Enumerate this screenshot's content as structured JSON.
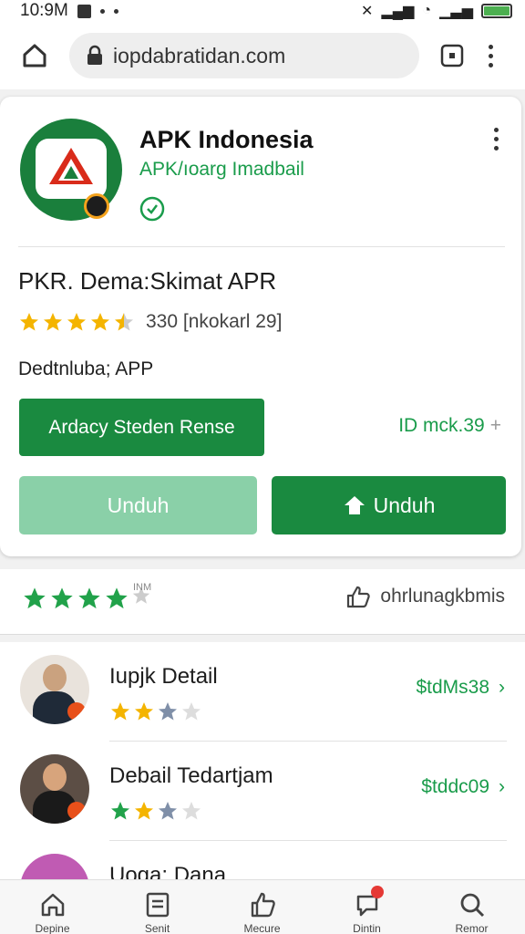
{
  "status_bar": {
    "time": "10:9M"
  },
  "browser": {
    "url": "iopdabratidan.com"
  },
  "app": {
    "name": "APK Indonesia",
    "publisher": "APK/ıoarg Imadbail",
    "title": "PKR. Dema:Skimat APR",
    "rating_text": "330 [nkokarl 29]",
    "category": "Dedtnluba; APP",
    "promo_label": "Ardacy Steden Rense",
    "price_label": "ID mck.39",
    "download_light_label": "Unduh",
    "download_dark_label": "Unduh",
    "stars": 4.5
  },
  "reviews": {
    "stars": 4,
    "stars_note": "INM",
    "share_label": "ohrlunagkbmis"
  },
  "list": [
    {
      "title": "Iupjk Detail",
      "price": "$tdMs38",
      "rating": 2.5
    },
    {
      "title": "Debail Tedartjam",
      "price": "$tddc09",
      "rating": 2.5
    },
    {
      "title": "Uoga: Dana",
      "price": "",
      "rating": 0
    }
  ],
  "bottom_nav": [
    {
      "label": "Depine",
      "icon": "home-icon"
    },
    {
      "label": "Senit",
      "icon": "list-icon"
    },
    {
      "label": "Mecure",
      "icon": "like-icon"
    },
    {
      "label": "Dintin",
      "icon": "chat-icon"
    },
    {
      "label": "Remor",
      "icon": "search-icon"
    }
  ],
  "colors": {
    "brand_green": "#1a8a40",
    "light_green": "#8ad0a8",
    "accent_text_green": "#1a9c4b",
    "star_gold": "#f4b400",
    "star_green": "#21a24a"
  }
}
